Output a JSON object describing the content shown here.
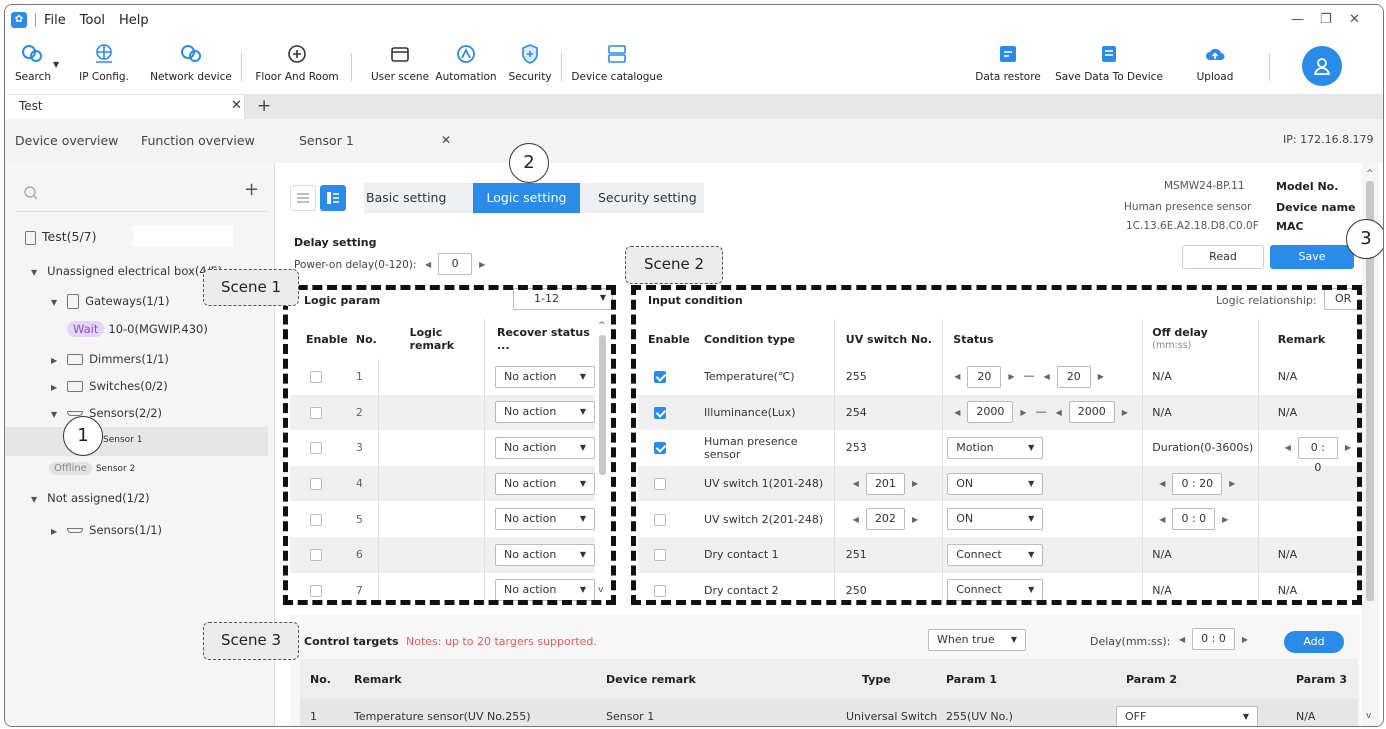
{
  "menu": [
    "File",
    "Tool",
    "Help"
  ],
  "toolbar": {
    "search": "Search",
    "ip_config": "IP Config.",
    "network_device": "Network device",
    "floor_room": "Floor And Room",
    "user_scene": "User scene",
    "automation": "Automation",
    "security": "Security",
    "device_catalogue": "Device catalogue",
    "data_restore": "Data restore",
    "save_data": "Save Data To Device",
    "upload": "Upload"
  },
  "file_tab": {
    "label": "Test",
    "close": "✕",
    "add": "+"
  },
  "subnav": {
    "device_overview": "Device overview",
    "function_overview": "Function overview",
    "sensor_tab": "Sensor 1",
    "close": "✕",
    "ip": "IP: 172.16.8.179"
  },
  "sidebar": {
    "add": "+",
    "root": "Test(5/7)",
    "unassigned": "Unassigned electrical box(4/5)",
    "gateways": "Gateways(1/1)",
    "wait_badge": "Wait",
    "gateway_item": "10-0(MGWIP.430)",
    "dimmers": "Dimmers(1/1)",
    "switches": "Switches(0/2)",
    "sensors": "Sensors(2/2)",
    "sensor1": "Sensor 1",
    "offline_badge": "Offline",
    "sensor2": "Sensor 2",
    "not_assigned": "Not assigned(1/2)",
    "sensors_na": "Sensors(1/1)"
  },
  "tabs": {
    "basic": "Basic setting",
    "logic": "Logic setting",
    "security": "Security setting"
  },
  "device_info": {
    "model_value": "MSMW24-BP.11",
    "model_label": "Model No.",
    "name_value": "Human presence sensor",
    "name_label": "Device name",
    "mac_value": "1C.13.6E.A2.18.D8.C0.0F",
    "mac_label": "MAC",
    "read": "Read",
    "save": "Save"
  },
  "delay": {
    "title": "Delay setting",
    "label": "Power-on delay(0-120):",
    "value": "0"
  },
  "logic_param": {
    "title": "Logic param",
    "range": "1-12",
    "headers": [
      "Enable",
      "No.",
      "Logic remark",
      "Recover status ..."
    ],
    "rows": [
      {
        "no": "1",
        "status": "No action"
      },
      {
        "no": "2",
        "status": "No action"
      },
      {
        "no": "3",
        "status": "No action"
      },
      {
        "no": "4",
        "status": "No action"
      },
      {
        "no": "5",
        "status": "No action"
      },
      {
        "no": "6",
        "status": "No action"
      },
      {
        "no": "7",
        "status": "No action"
      }
    ]
  },
  "input_condition": {
    "title": "Input condition",
    "relationship_label": "Logic relationship:",
    "relationship_value": "OR",
    "headers": [
      "Enable",
      "Condition type",
      "UV switch No.",
      "Status",
      "Off delay",
      "(mm:ss)",
      "Remark"
    ],
    "rows": [
      {
        "enabled": true,
        "type": "Temperature(℃)",
        "uv": "255",
        "status_a": "20",
        "status_b": "20",
        "off": "N/A",
        "remark": "N/A"
      },
      {
        "enabled": true,
        "type": "Illuminance(Lux)",
        "uv": "254",
        "status_a": "2000",
        "status_b": "2000",
        "off": "N/A",
        "remark": "N/A"
      },
      {
        "enabled": true,
        "type": "Human presence sensor",
        "uv": "253",
        "status_sel": "Motion",
        "off": "Duration(0-3600s)",
        "remark_spin": "0 : 0"
      },
      {
        "enabled": false,
        "type": "UV switch 1(201-248)",
        "uv_spin": "201",
        "status_sel": "ON",
        "off_spin": "0 : 20",
        "remark": ""
      },
      {
        "enabled": false,
        "type": "UV switch 2(201-248)",
        "uv_spin": "202",
        "status_sel": "ON",
        "off_spin": "0 : 0",
        "remark": ""
      },
      {
        "enabled": false,
        "type": "Dry contact 1",
        "uv": "251",
        "status_sel": "Connect",
        "off": "N/A",
        "remark": "N/A"
      },
      {
        "enabled": false,
        "type": "Dry contact 2",
        "uv": "250",
        "status_sel": "Connect",
        "off": "N/A",
        "remark": "N/A"
      }
    ]
  },
  "control": {
    "title": "Control targets",
    "note": "Notes: up to 20 targers supported.",
    "when": "When true",
    "delay_label": "Delay(mm:ss):",
    "delay_value": "0 : 0",
    "add": "Add",
    "headers": [
      "No.",
      "Remark",
      "Device remark",
      "Type",
      "Param 1",
      "Param 2",
      "Param 3"
    ],
    "row": {
      "no": "1",
      "remark": "Temperature sensor(UV No.255)",
      "device": "Sensor 1",
      "type": "Universal Switch",
      "p1": "255(UV No.)",
      "p2": "OFF",
      "p3": "N/A"
    }
  },
  "callouts": {
    "scene1": "Scene 1",
    "scene2": "Scene 2",
    "scene3": "Scene 3",
    "n1": "1",
    "n2": "2",
    "n3": "3"
  },
  "colors": {
    "accent": "#2a8be8",
    "note_red": "#e85a5a"
  }
}
